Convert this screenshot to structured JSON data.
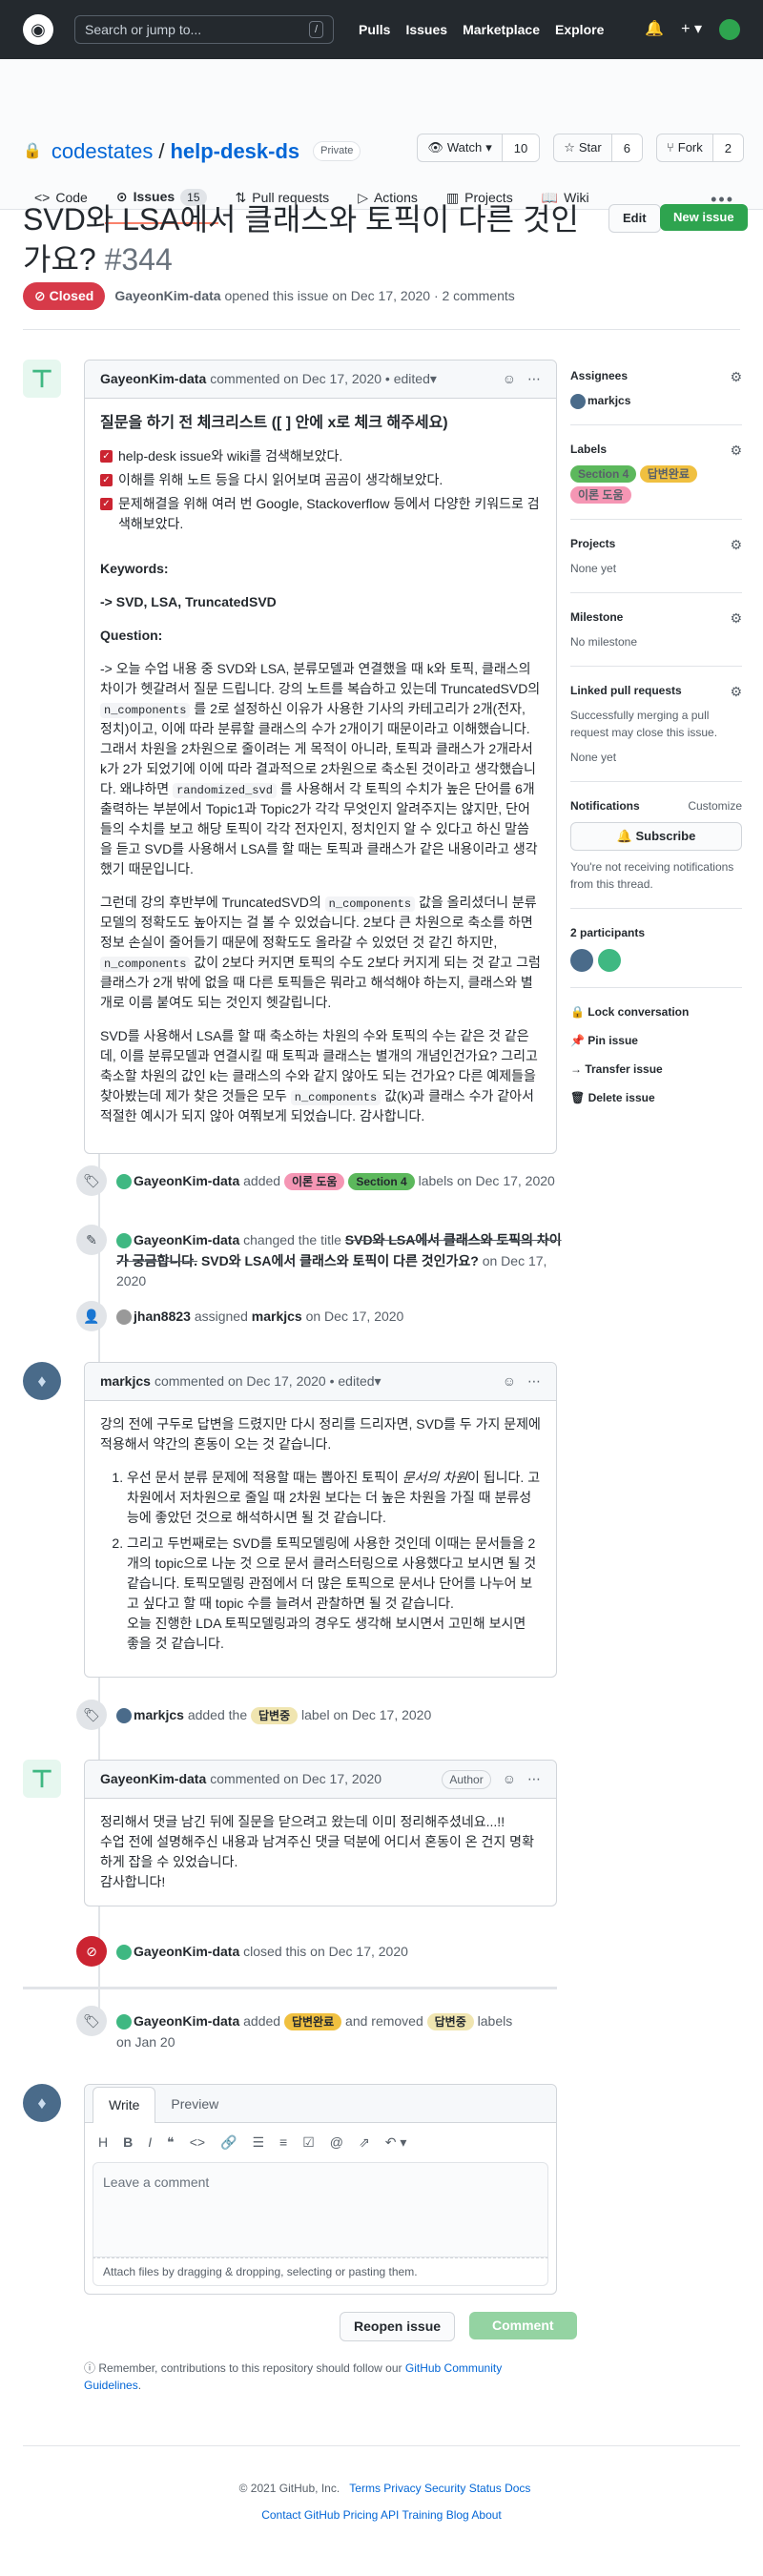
{
  "header": {
    "search_placeholder": "Search or jump to...",
    "slash": "/",
    "nav": [
      "Pulls",
      "Issues",
      "Marketplace",
      "Explore"
    ]
  },
  "repo": {
    "owner": "codestates",
    "name": "help-desk-ds",
    "visibility": "Private",
    "watch": "Watch",
    "watch_count": "10",
    "star": "Star",
    "star_count": "6",
    "fork": "Fork",
    "fork_count": "2"
  },
  "tabs": [
    {
      "label": "Code"
    },
    {
      "label": "Issues",
      "count": "15"
    },
    {
      "label": "Pull requests"
    },
    {
      "label": "Actions"
    },
    {
      "label": "Projects"
    },
    {
      "label": "Wiki"
    }
  ],
  "issue": {
    "title": "SVD와 LSA에서 클래스와 토픽이 다른 것인가요?",
    "number": "#344",
    "edit": "Edit",
    "new_issue": "New issue",
    "state": "Closed",
    "author": "GayeonKim-data",
    "meta": "opened this issue on Dec 17, 2020 · 2 comments"
  },
  "c1": {
    "author": "GayeonKim-data",
    "meta": "commented on Dec 17, 2020 • edited",
    "heading": "질문을 하기 전 체크리스트 ([ ] 안에 x로 체크 해주세요)",
    "checks": [
      "help-desk issue와 wiki를 검색해보았다.",
      "이해를 위해 노트 등을 다시 읽어보며 곰곰이 생각해보았다.",
      "문제해결을 위해 여러 번 Google, Stackoverflow 등에서 다양한 키워드로 검색해보았다."
    ],
    "kw_label": "Keywords:",
    "kw": "-> SVD, LSA, TruncatedSVD",
    "q_label": "Question:",
    "p1a": "-> 오늘 수업 내용 중 SVD와 LSA, 분류모델과 연결했을 때 k와 토픽, 클래스의 차이가 헷갈려서 질문 드립니다. 강의 노트를 복습하고 있는데 TruncatedSVD의 ",
    "code1": "n_components",
    "p1b": " 를 2로 설정하신 이유가 사용한 기사의 카테고리가 2개(전자, 정치)이고, 이에 따라 분류할 클래스의 수가 2개이기 때문이라고 이해했습니다. 그래서 차원을 2차원으로 줄이려는 게 목적이 아니라, 토픽과 클래스가 2개라서 k가 2가 되었기에 이에 따라 결과적으로 2차원으로 축소된 것이라고 생각했습니다. 왜냐하면 ",
    "code2": "randomized_svd",
    "p1c": " 를 사용해서 각 토픽의 수치가 높은 단어를 6개 출력하는 부분에서 Topic1과 Topic2가 각각 무엇인지 알려주지는 않지만, 단어들의 수치를 보고 해당 토픽이 각각 전자인지, 정치인지 알 수 있다고 하신 말씀을 듣고 SVD를 사용해서 LSA를 할 때는 토픽과 클래스가 같은 내용이라고 생각했기 때문입니다.",
    "p2a": "그런데 강의 후반부에 TruncatedSVD의 ",
    "code3": "n_components",
    "p2b": " 값을 올리셨더니 분류모델의 정확도도 높아지는 걸 볼 수 있었습니다. 2보다 큰 차원으로 축소를 하면 정보 손실이 줄어들기 때문에 정확도도 올라갈 수 있었던 것 같긴 하지만, ",
    "code4": "n_components",
    "p2c": " 값이 2보다 커지면 토픽의 수도 2보다 커지게 되는 것 같고 그럼 클래스가 2개 밖에 없을 때 다른 토픽들은 뭐라고 해석해야 하는지, 클래스와 별개로 이름 붙여도 되는 것인지 헷갈립니다.",
    "p3a": "SVD를 사용해서 LSA를 할 때 축소하는 차원의 수와 토픽의 수는 같은 것 같은데, 이를 분류모델과 연결시킬 때 토픽과 클래스는 별개의 개념인건가요? 그리고 축소할 차원의 값인 k는 클래스의 수와 같지 않아도 되는 건가요? 다른 예제들을 찾아봤는데 제가 찾은 것들은 모두 ",
    "code5": "n_components",
    "p3b": " 값(k)과 클래스 수가 같아서 적절한 예시가 되지 않아 여쭤보게 되었습니다. 감사합니다."
  },
  "ev1": {
    "actor": "GayeonKim-data",
    "verb": "added",
    "labels": [
      "이론 도움",
      "Section 4"
    ],
    "tail": "labels on Dec 17, 2020"
  },
  "ev2": {
    "actor": "GayeonKim-data",
    "verb": "changed the title",
    "old": "SVD와 LSA에서 클래스와 토픽의 차이가 궁금합니다.",
    "new": "SVD와 LSA에서 클래스와 토픽이 다른 것인가요?",
    "tail": "on Dec 17, 2020"
  },
  "ev3": {
    "actor": "jhan8823",
    "verb": "assigned",
    "target": "markjcs",
    "tail": "on Dec 17, 2020"
  },
  "c2": {
    "author": "markjcs",
    "meta": "commented on Dec 17, 2020 • edited",
    "p": "강의 전에 구두로 답변을 드렸지만 다시 정리를 드리자면, SVD를 두 가지 문제에 적용해서 약간의 혼동이 오는 것 같습니다.",
    "li1a": "우선 문서 분류 문제에 적용할 때는 뽑아진 토픽이 ",
    "li1em": "문서의 차원",
    "li1b": "이 됩니다. 고차원에서 저차원으로 줄일 때 2차원 보다는 더 높은 차원을 가질 때 분류성능에 좋았던 것으로 해석하시면 될 것 같습니다.",
    "li2": "그리고 두번째로는 SVD를 토픽모델링에 사용한 것인데 이때는 문서들을 2개의 topic으로 나눈 것 으로 문서 클러스터링으로 사용했다고 보시면 될 것 같습니다. 토픽모델링 관점에서 더 많은 토픽으로 문서나 단어를 나누어 보고 싶다고 할 때 topic 수를 늘려서 관찰하면 될 것 같습니다.",
    "li2b": "오늘 진행한 LDA 토픽모델링과의 경우도 생각해 보시면서 고민해 보시면 좋을 것 같습니다."
  },
  "ev4": {
    "actor": "markjcs",
    "verb": "added the",
    "label": "답변중",
    "tail": "label on Dec 17, 2020"
  },
  "c3": {
    "author": "GayeonKim-data",
    "meta": "commented on Dec 17, 2020",
    "badge": "Author",
    "lines": [
      "정리해서 댓글 남긴 뒤에 질문을 닫으려고 왔는데 이미 정리해주셨네요...!!",
      "수업 전에 설명해주신 내용과 남겨주신 댓글 덕분에 어디서 혼동이 온 건지 명확하게 잡을 수 있었습니다.",
      "감사합니다!"
    ]
  },
  "ev5": {
    "actor": "GayeonKim-data",
    "tail": "closed this on Dec 17, 2020"
  },
  "ev6": {
    "actor": "GayeonKim-data",
    "verb": "added",
    "label_added": "답변완료",
    "mid": "and removed",
    "label_removed": "답변중",
    "tail": "labels",
    "date": "on Jan 20"
  },
  "editor": {
    "tab_write": "Write",
    "tab_preview": "Preview",
    "placeholder": "Leave a comment",
    "attach": "Attach files by dragging & dropping, selecting or pasting them.",
    "reopen": "Reopen issue",
    "comment": "Comment",
    "remember": "Remember, contributions to this repository should follow our",
    "guidelines": "GitHub Community Guidelines"
  },
  "sidebar": {
    "assignees": "Assignees",
    "assignee": "markjcs",
    "labels": "Labels",
    "label_list": [
      "Section 4",
      "답변완료",
      "이론 도움"
    ],
    "projects": "Projects",
    "projects_val": "None yet",
    "milestone": "Milestone",
    "milestone_val": "No milestone",
    "linked": "Linked pull requests",
    "linked_desc": "Successfully merging a pull request may close this issue.",
    "linked_val": "None yet",
    "notif": "Notifications",
    "customize": "Customize",
    "subscribe": "Subscribe",
    "notif_desc": "You're not receiving notifications from this thread.",
    "participants": "2 participants",
    "lock": "Lock conversation",
    "pin": "Pin issue",
    "transfer": "Transfer issue",
    "delete": "Delete issue"
  },
  "footer": {
    "row1": [
      "© 2021 GitHub, Inc.",
      "Terms",
      "Privacy",
      "Security",
      "Status",
      "Docs"
    ],
    "row2": [
      "Contact GitHub",
      "Pricing",
      "API",
      "Training",
      "Blog",
      "About"
    ]
  },
  "colors": {
    "section4": "#5cb85c",
    "answered": "#f0c040",
    "theory": "#f596b4",
    "answering": "#f0e5b0"
  }
}
